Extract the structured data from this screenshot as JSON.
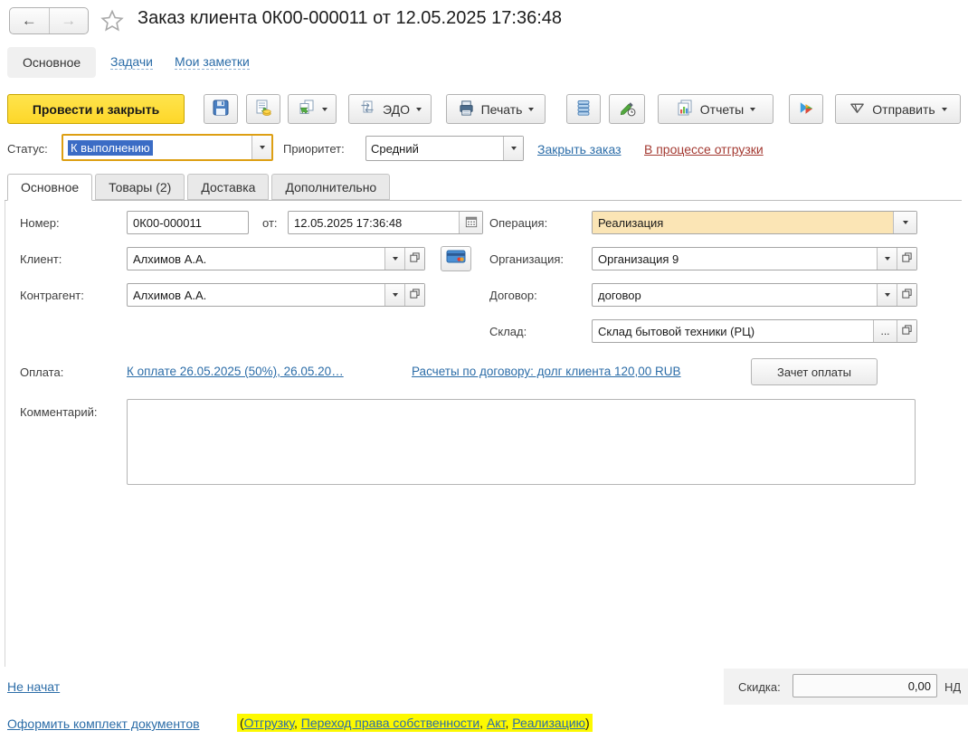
{
  "header": {
    "title": "Заказ клиента 0К00-000011 от 12.05.2025 17:36:48"
  },
  "nav_tabs": {
    "main": "Основное",
    "tasks": "Задачи",
    "notes": "Мои заметки"
  },
  "toolbar": {
    "post_close": "Провести и закрыть",
    "edo": "ЭДО",
    "print": "Печать",
    "reports": "Отчеты",
    "send": "Отправить"
  },
  "status_row": {
    "status_label": "Статус:",
    "status_value": "К выполнению",
    "priority_label": "Приоритет:",
    "priority_value": "Средний",
    "close_order": "Закрыть заказ",
    "shipping_state": "В процессе отгрузки"
  },
  "inner_tabs": [
    "Основное",
    "Товары (2)",
    "Доставка",
    "Дополнительно"
  ],
  "form": {
    "number_label": "Номер:",
    "number_value": "0К00-000011",
    "date_label": "от:",
    "date_value": "12.05.2025 17:36:48",
    "operation_label": "Операция:",
    "operation_value": "Реализация",
    "client_label": "Клиент:",
    "client_value": "Алхимов А.А.",
    "org_label": "Организация:",
    "org_value": "Организация 9",
    "counterparty_label": "Контрагент:",
    "counterparty_value": "Алхимов А.А.",
    "contract_label": "Договор:",
    "contract_value": "договор",
    "warehouse_label": "Склад:",
    "warehouse_value": "Склад бытовой техники (РЦ)",
    "warehouse_ellipsis": "...",
    "payment_label": "Оплата:",
    "payment_link1": "К оплате 26.05.2025 (50%), 26.05.20…",
    "payment_link2": "Расчеты по договору: долг клиента 120,00 RUB",
    "payment_offset_button": "Зачет оплаты",
    "comment_label": "Комментарий:",
    "comment_value": ""
  },
  "footer": {
    "not_started": "Не начат",
    "discount_label": "Скидка:",
    "discount_value": "0,00",
    "vat_truncated": "НД",
    "make_docs": "Оформить комплект документов",
    "paren_open": "(",
    "paren_close": ")",
    "sep": ", ",
    "docs_links": [
      "Отгрузку",
      "Переход права собственности",
      "Акт",
      "Реализацию"
    ]
  }
}
